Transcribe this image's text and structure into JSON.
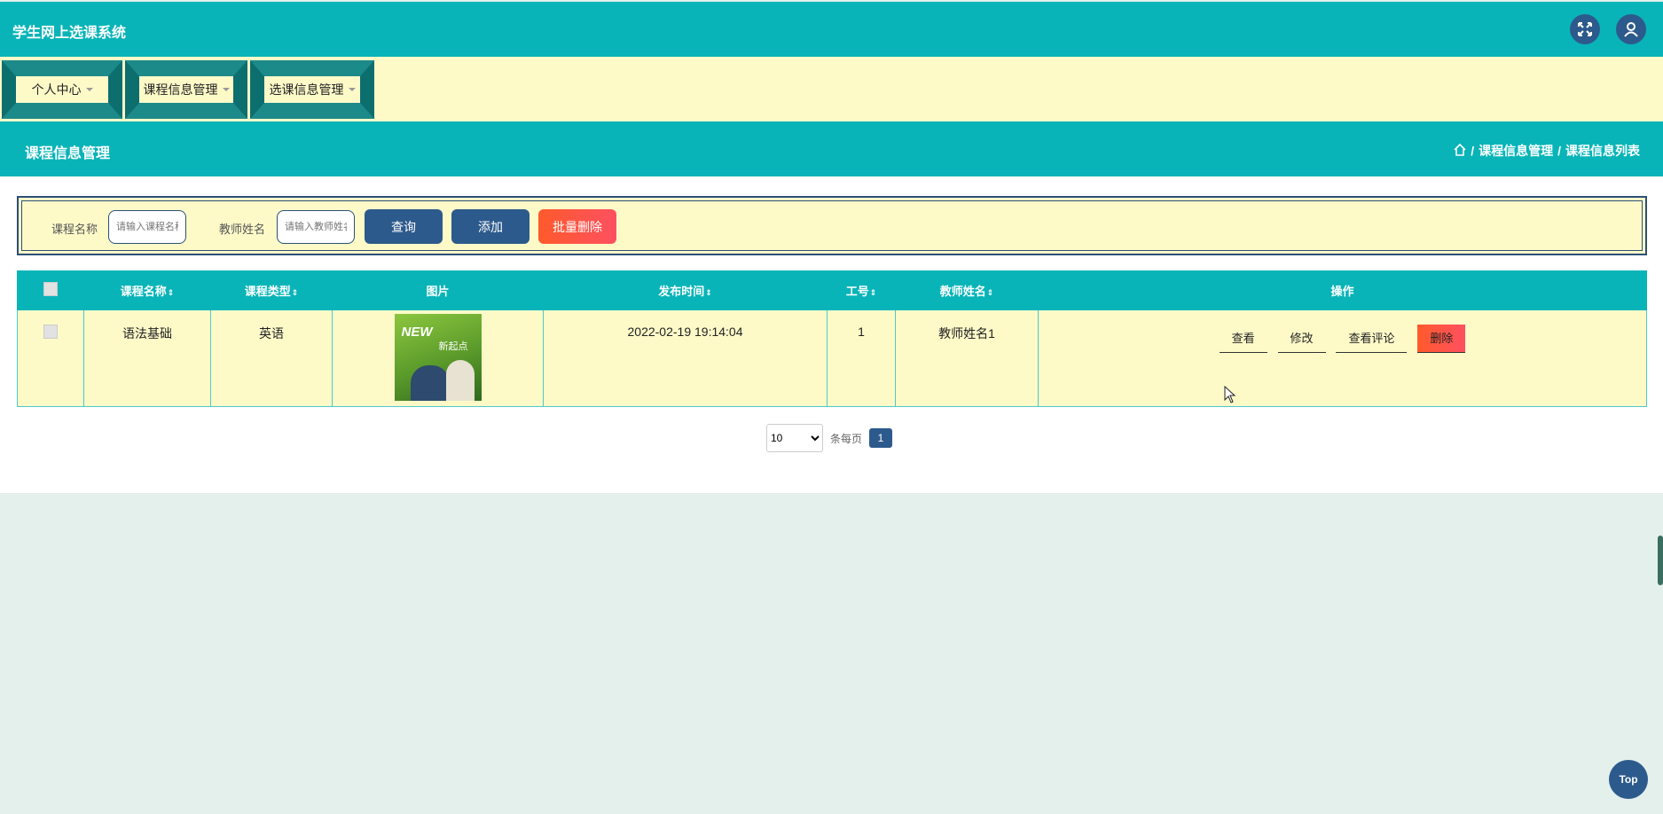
{
  "app": {
    "title": "学生网上选课系统"
  },
  "header": {
    "fullscreen_icon": "expand-icon",
    "user_icon": "user-icon"
  },
  "menu": [
    {
      "label": "个人中心"
    },
    {
      "label": "课程信息管理"
    },
    {
      "label": "选课信息管理"
    }
  ],
  "page": {
    "title": "课程信息管理"
  },
  "breadcrumb": {
    "home_icon": "home-icon",
    "items": [
      "课程信息管理",
      "课程信息列表"
    ],
    "sep": "/"
  },
  "search": {
    "course_label": "课程名称",
    "course_placeholder": "请输入课程名称",
    "teacher_label": "教师姓名",
    "teacher_placeholder": "请输入教师姓名",
    "query_label": "查询",
    "add_label": "添加",
    "batch_delete_label": "批量删除"
  },
  "table": {
    "columns": [
      "课程名称",
      "课程类型",
      "图片",
      "发布时间",
      "工号",
      "教师姓名",
      "操作"
    ],
    "sort_glyph": "⇕",
    "rows": [
      {
        "course_name": "语法基础",
        "course_type": "英语",
        "image_text": "NEW",
        "image_subtext": "新起点",
        "publish_time": "2022-02-19 19:14:04",
        "job_no": "1",
        "teacher_name": "教师姓名1",
        "actions": {
          "view": "查看",
          "edit": "修改",
          "comments": "查看评论",
          "delete": "删除"
        }
      }
    ]
  },
  "pager": {
    "page_size": "10",
    "per_page_label": "条每页",
    "current_page": "1"
  },
  "top_button": {
    "label": "Top"
  },
  "colors": {
    "primary": "#08b4b8",
    "accent_blue": "#2d5a8c",
    "danger": "#ff5a3c",
    "panel": "#fdfac8"
  }
}
